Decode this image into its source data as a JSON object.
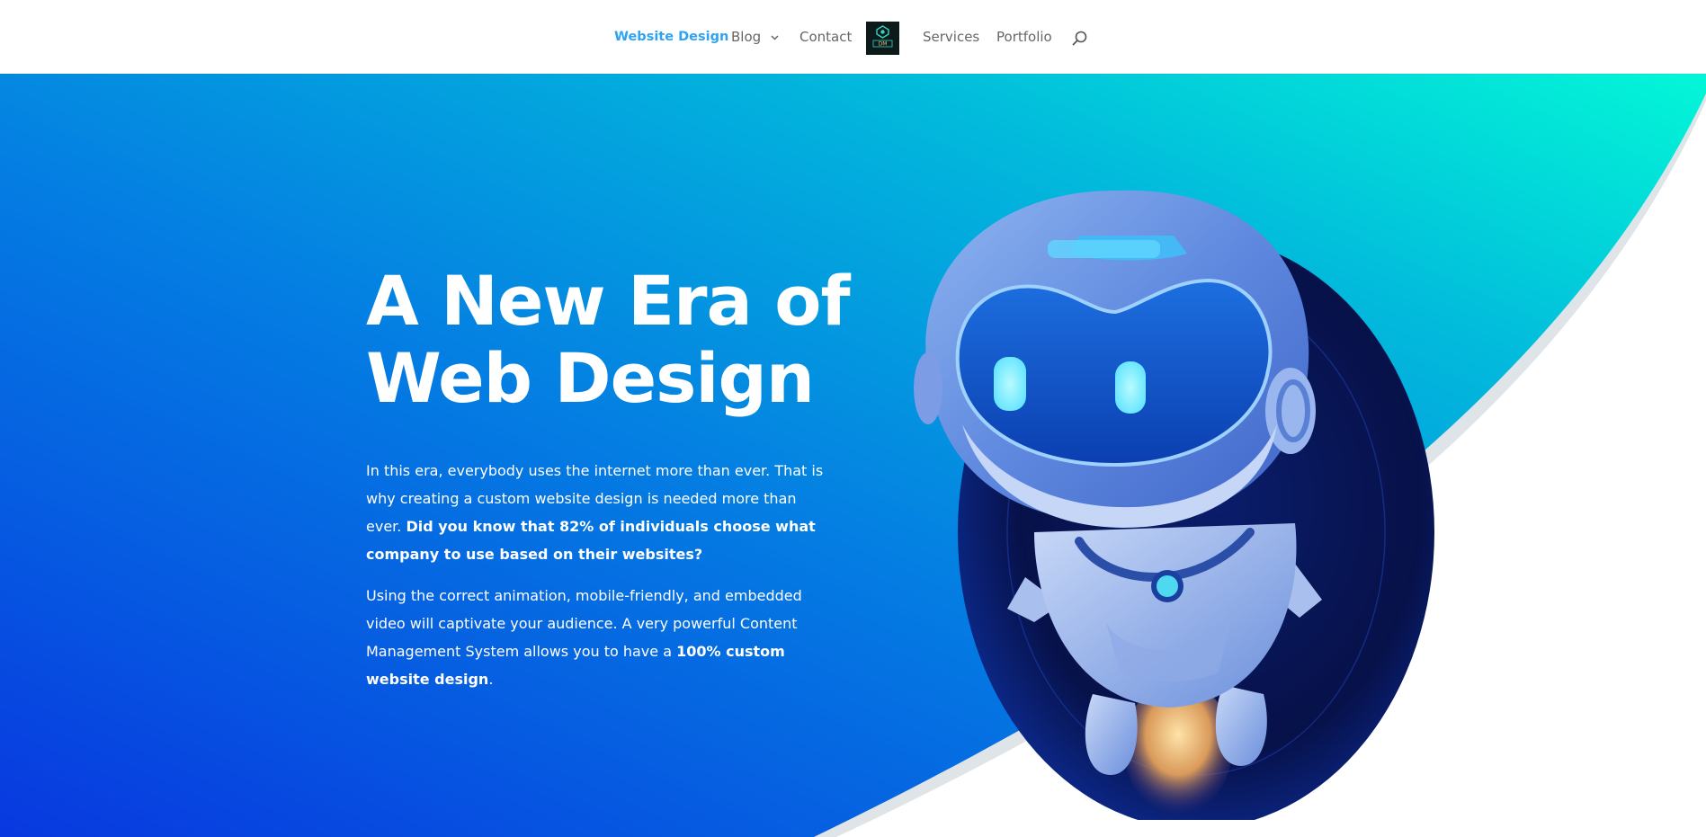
{
  "nav": {
    "items": [
      {
        "label": "Website Design",
        "active": true
      },
      {
        "label": "Blog",
        "has_dropdown": true
      },
      {
        "label": "Contact"
      },
      {
        "label": "Services"
      },
      {
        "label": "Portfolio"
      }
    ],
    "logo_text": "DM",
    "search_icon": "search-icon",
    "dropdown_icon": "chevron-down-icon"
  },
  "hero": {
    "title": "A New Era of Web Design",
    "paragraph1": {
      "normal": "In this era, everybody uses the internet more than ever. That is why creating a custom website design is needed more than ever. ",
      "bold": "Did you know that 82% of individuals choose what company to use based on their websites?"
    },
    "paragraph2": {
      "normal": "Using the correct animation, mobile-friendly, and embedded video will captivate your audience. A very powerful Content Management System allows you to have a ",
      "bold": "100% custom website design",
      "end": "."
    },
    "illustration": "robot-astronaut-illustration"
  },
  "colors": {
    "nav_active": "#2ea3f2",
    "nav_text": "#666666",
    "gradient_start": "#0a3de0",
    "gradient_mid": "#0393dd",
    "gradient_end": "#03f7d7",
    "hero_text": "#ffffff"
  }
}
